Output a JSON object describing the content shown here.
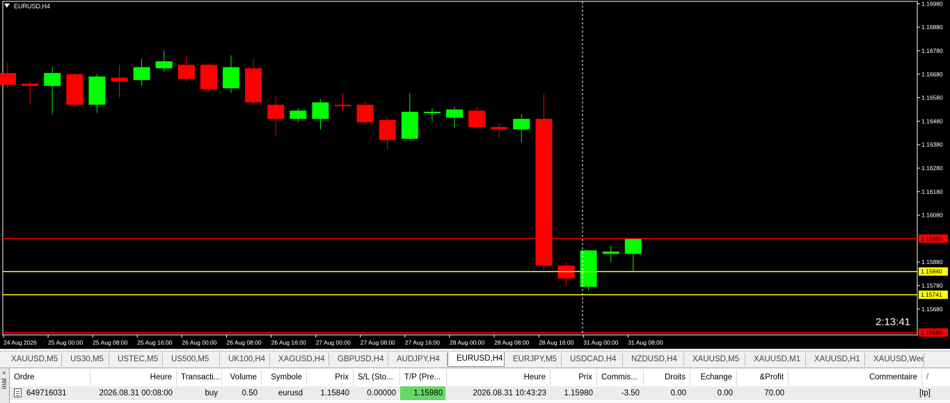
{
  "chart": {
    "title": "EURUSD,H4",
    "countdown": "2:13:41",
    "colors": {
      "background": "#000000",
      "bull": "#00ff00",
      "bear": "#ff0000",
      "line_red": "#ff0000",
      "line_yellow": "#ffff00",
      "axis_text": "#ffffff"
    }
  },
  "chart_data": {
    "type": "candlestick",
    "title": "EURUSD,H4",
    "ylim": [
      1.1557,
      1.1699
    ],
    "yticks": [
      "1.16980",
      "1.16880",
      "1.16780",
      "1.16680",
      "1.16580",
      "1.16480",
      "1.16380",
      "1.16280",
      "1.16180",
      "1.16080",
      "1.15880",
      "1.15780",
      "1.15680"
    ],
    "xticks": [
      "24 Aug 2026",
      "25 Aug 00:00",
      "25 Aug 08:00",
      "25 Aug 16:00",
      "26 Aug 00:00",
      "26 Aug 08:00",
      "26 Aug 16:00",
      "27 Aug 00:00",
      "27 Aug 08:00",
      "27 Aug 16:00",
      "28 Aug 00:00",
      "28 Aug 08:00",
      "28 Aug 16:00",
      "31 Aug 00:00",
      "31 Aug 08:00"
    ],
    "candles": [
      {
        "o": 1.16685,
        "h": 1.1673,
        "l": 1.1662,
        "c": 1.16635
      },
      {
        "o": 1.1664,
        "h": 1.1665,
        "l": 1.1655,
        "c": 1.1663
      },
      {
        "o": 1.1663,
        "h": 1.1671,
        "l": 1.1651,
        "c": 1.16685
      },
      {
        "o": 1.1668,
        "h": 1.16685,
        "l": 1.1654,
        "c": 1.1655
      },
      {
        "o": 1.1655,
        "h": 1.1668,
        "l": 1.16515,
        "c": 1.1667
      },
      {
        "o": 1.16665,
        "h": 1.1672,
        "l": 1.1658,
        "c": 1.1665
      },
      {
        "o": 1.16655,
        "h": 1.16745,
        "l": 1.1663,
        "c": 1.1671
      },
      {
        "o": 1.16705,
        "h": 1.1678,
        "l": 1.1669,
        "c": 1.16735
      },
      {
        "o": 1.1672,
        "h": 1.1676,
        "l": 1.1665,
        "c": 1.1666
      },
      {
        "o": 1.1672,
        "h": 1.16725,
        "l": 1.16605,
        "c": 1.16615
      },
      {
        "o": 1.1662,
        "h": 1.1676,
        "l": 1.166,
        "c": 1.1671
      },
      {
        "o": 1.16705,
        "h": 1.16745,
        "l": 1.1655,
        "c": 1.1656
      },
      {
        "o": 1.1655,
        "h": 1.16585,
        "l": 1.1642,
        "c": 1.1649
      },
      {
        "o": 1.1649,
        "h": 1.16535,
        "l": 1.16475,
        "c": 1.16525
      },
      {
        "o": 1.1649,
        "h": 1.16575,
        "l": 1.16445,
        "c": 1.1656
      },
      {
        "o": 1.1655,
        "h": 1.166,
        "l": 1.16525,
        "c": 1.16545
      },
      {
        "o": 1.1655,
        "h": 1.16565,
        "l": 1.1647,
        "c": 1.16475
      },
      {
        "o": 1.16485,
        "h": 1.16495,
        "l": 1.1636,
        "c": 1.164
      },
      {
        "o": 1.16405,
        "h": 1.166,
        "l": 1.164,
        "c": 1.1652
      },
      {
        "o": 1.1652,
        "h": 1.16535,
        "l": 1.1648,
        "c": 1.1652
      },
      {
        "o": 1.16495,
        "h": 1.1654,
        "l": 1.1645,
        "c": 1.1653
      },
      {
        "o": 1.16525,
        "h": 1.1654,
        "l": 1.1645,
        "c": 1.16455
      },
      {
        "o": 1.16455,
        "h": 1.1647,
        "l": 1.1641,
        "c": 1.16445
      },
      {
        "o": 1.16445,
        "h": 1.1651,
        "l": 1.1639,
        "c": 1.1649
      },
      {
        "o": 1.1649,
        "h": 1.166,
        "l": 1.1585,
        "c": 1.15865
      },
      {
        "o": 1.15865,
        "h": 1.1588,
        "l": 1.1578,
        "c": 1.1581
      },
      {
        "o": 1.15775,
        "h": 1.1593,
        "l": 1.1576,
        "c": 1.1593
      },
      {
        "o": 1.15915,
        "h": 1.1595,
        "l": 1.1588,
        "c": 1.15925
      },
      {
        "o": 1.15915,
        "h": 1.1598,
        "l": 1.1584,
        "c": 1.1598
      }
    ],
    "levels": [
      {
        "price": 1.1598,
        "label": "1.15980",
        "color": "#ff0000"
      },
      {
        "price": 1.1584,
        "label": "1.15840",
        "color": "#ffff00"
      },
      {
        "price": 1.15741,
        "label": "1.15741",
        "color": "#ffff00"
      },
      {
        "price": 1.1558,
        "label": "1.15580",
        "color": "#ff0000"
      }
    ],
    "grid": false
  },
  "tabs": [
    "XAUUSD,M5",
    "US30,M5",
    "USTEC,M5",
    "US500,M5",
    "UK100,H4",
    "XAGUSD,H4",
    "GBPUSD,H4",
    "AUDJPY,H4",
    "EURUSD,H4",
    "EURJPY,M5",
    "USDCAD,H4",
    "NZDUSD,H4",
    "XAUUSD,M5",
    "XAUUSD,M1",
    "XAUUSD,H1",
    "XAUUSD,Weekl"
  ],
  "active_tab": "EURUSD,H4",
  "terminal": {
    "side_label": "inal",
    "close_glyph": "×",
    "headers": {
      "ordre": "Ordre",
      "heure": "Heure",
      "transaction": "Transacti...",
      "volume": "Volume",
      "symbole": "Symbole",
      "prix": "Prix",
      "sl": "S/L (Sto...",
      "tp": "T/P (Pre...",
      "heure2": "Heure",
      "prix2": "Prix",
      "commission": "Commis...",
      "droits": "Droits",
      "echange": "Echange",
      "profit": "&Profit",
      "commentaire": "Commentaire",
      "sort_glyph": "/"
    },
    "row": {
      "ordre": "649716031",
      "heure": "2026.08.31 00:08:00",
      "transaction": "buy",
      "volume": "0.50",
      "symbole": "eurusd",
      "prix": "1.15840",
      "sl": "0.00000",
      "tp": "1.15980",
      "heure2": "2026.08.31 10:43:23",
      "prix2": "1.15980",
      "commission": "-3.50",
      "droits": "0.00",
      "echange": "0.00",
      "profit": "70.00",
      "commentaire": "[tp]"
    }
  }
}
